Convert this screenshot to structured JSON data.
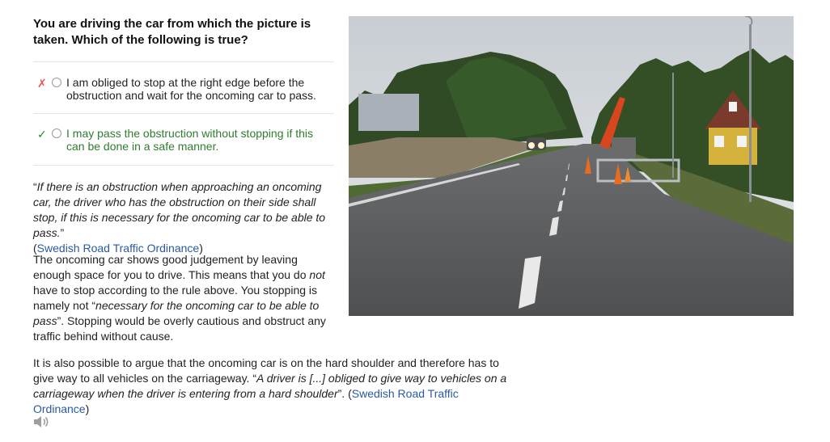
{
  "question": {
    "title": "You are driving the car from which the picture is taken. Which of the following is true?"
  },
  "options": [
    {
      "mark": "✗",
      "text": "I am obliged to stop at the right edge before the obstruction and wait for the oncoming car to pass.",
      "status": "incorrect"
    },
    {
      "mark": "✓",
      "text": "I may pass the obstruction without stopping if this can be done in a safe manner.",
      "status": "correct"
    }
  ],
  "explanation": {
    "quote_open": "“",
    "quote_text": "If there is an obstruction when approaching an oncoming car, the driver who has the obstruction on their side shall stop, if this is necessary for the oncoming car to be able to pass.",
    "quote_close": "”",
    "source_open": "(",
    "source_link": "Swedish Road Traffic Ordinance",
    "source_close": ")",
    "p2_a": "The oncoming car shows good judgement by leaving enough space for you to drive. This means that you do ",
    "p2_not": "not",
    "p2_b": " have to stop according to the rule above. You stopping is namely not “",
    "p2_quote": "necessary for the oncoming car to be able to pass",
    "p2_c": "”. Stopping would be overly cautious and obstruct any traffic behind without cause.",
    "p3_a": "It is also possible to argue that the oncoming car is on the hard shoulder and therefore has to give way to all vehicles on the carriageway. “",
    "p3_quote": "A driver is [...] obliged to give way to vehicles on a carriageway when the driver is entering from a hard shoulder",
    "p3_b": "”. (",
    "p3_link": "Swedish Road Traffic Ordinance",
    "p3_c": ")"
  },
  "colors": {
    "correct": "#2e7d2e",
    "incorrect_mark": "#e05a4e",
    "link": "#2a5a9e"
  },
  "icons": {
    "wrong": "cross-mark-icon",
    "right": "check-mark-icon",
    "audio": "speaker-icon"
  }
}
